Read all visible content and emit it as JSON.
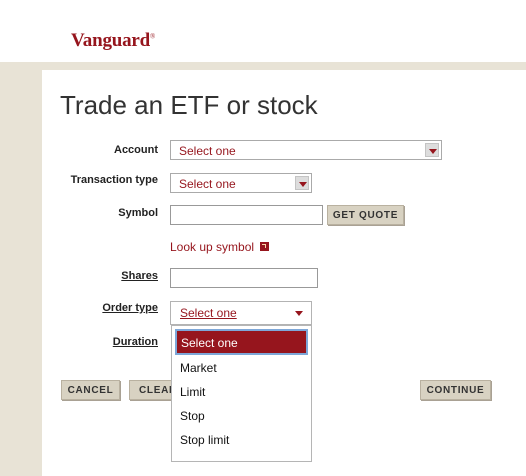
{
  "brand": {
    "logo_text": "Vanguard",
    "logo_mark": "®",
    "accent": "#96151d"
  },
  "page": {
    "title": "Trade an ETF or stock"
  },
  "form": {
    "account": {
      "label": "Account",
      "value": "Select one"
    },
    "transaction_type": {
      "label": "Transaction type",
      "value": "Select one"
    },
    "symbol": {
      "label": "Symbol",
      "value": "",
      "get_quote": "GET QUOTE"
    },
    "lookup_symbol": "Look up symbol",
    "shares": {
      "label": "Shares",
      "value": ""
    },
    "order_type": {
      "label": "Order type",
      "value": "Select one"
    },
    "duration": {
      "label": "Duration"
    }
  },
  "dropdown": {
    "options": [
      "Select one",
      "Market",
      "Limit",
      "Stop",
      "Stop limit"
    ],
    "selected_index": 0
  },
  "buttons": {
    "cancel": "CANCEL",
    "clear": "CLEAR",
    "continue": "CONTINUE"
  }
}
